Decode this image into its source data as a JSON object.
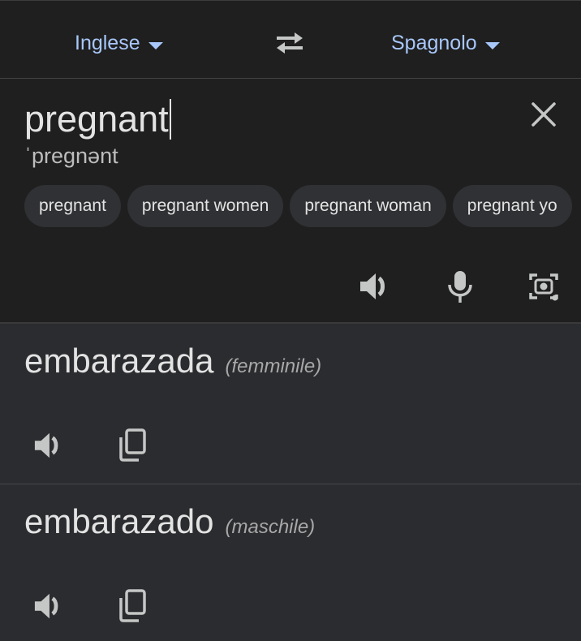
{
  "language_bar": {
    "source_lang": "Inglese",
    "target_lang": "Spagnolo",
    "swap_icon": "swap-arrows-icon"
  },
  "source": {
    "text": "pregnant",
    "phonetic": "ˈpregnənt",
    "suggestions": [
      "pregnant",
      "pregnant women",
      "pregnant woman",
      "pregnant yo"
    ],
    "icons": [
      "close-icon",
      "speaker-icon",
      "microphone-icon",
      "camera-lens-icon"
    ]
  },
  "results": [
    {
      "word": "embarazada",
      "gender": "(femminile)"
    },
    {
      "word": "embarazado",
      "gender": "(maschile)"
    }
  ],
  "colors": {
    "background": "#1f1f1f",
    "result_background": "#2b2c2f",
    "accent": "#a8c7fa",
    "chip": "#303134",
    "icon": "#c4c7c5"
  }
}
